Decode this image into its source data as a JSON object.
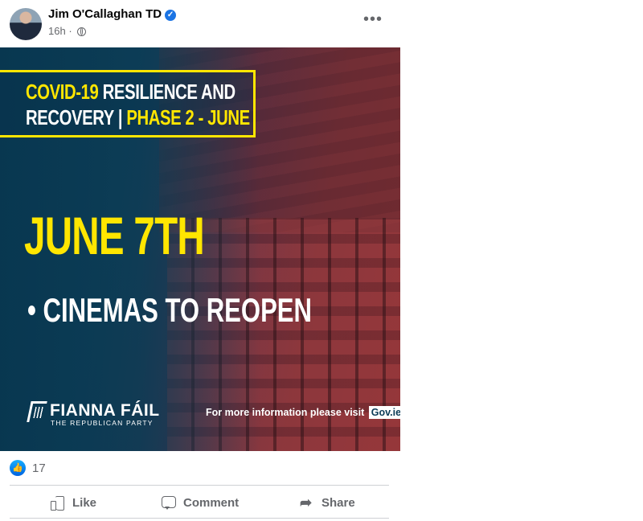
{
  "post": {
    "author": "Jim O'Callaghan TD",
    "verified_icon": "verified-badge-icon",
    "time": "16h",
    "separator": "·",
    "audience_icon": "globe-icon",
    "more_label": "•••"
  },
  "poster": {
    "title_line1_yellow": "COVID-19",
    "title_line1_white": "RESILIENCE AND",
    "title_line2_white": "RECOVERY |",
    "title_line2_yellow": "PHASE 2 - JUNE",
    "date": "JUNE 7TH",
    "bullet": "•",
    "item": "CINEMAS TO REOPEN",
    "logo_name": "FIANNA FÁIL",
    "logo_sub": "THE REPUBLICAN PARTY",
    "more_info": "For more information please visit",
    "gov_link": "Gov.ie",
    "colors": {
      "accent": "#ffe600",
      "background": "#0a3a55"
    }
  },
  "reactions": {
    "icon": "like-reaction-icon",
    "count": "17"
  },
  "actions": {
    "like": "Like",
    "comment": "Comment",
    "share": "Share"
  }
}
